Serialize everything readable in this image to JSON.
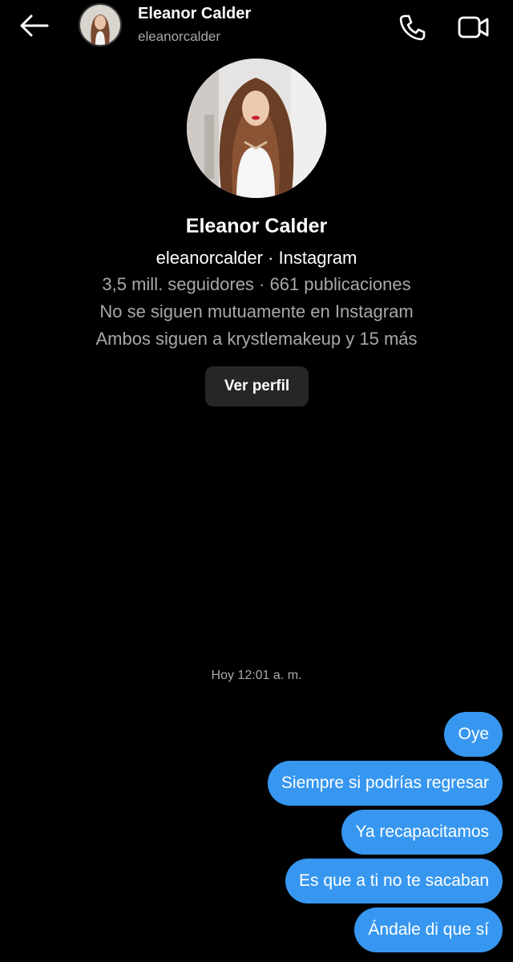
{
  "header": {
    "name": "Eleanor Calder",
    "handle": "eleanorcalder",
    "back_icon": "arrow-left-icon",
    "call_icon": "phone-icon",
    "video_icon": "video-camera-icon"
  },
  "profile": {
    "name": "Eleanor Calder",
    "handle_line": "eleanorcalder · Instagram",
    "stats_line": "3,5 mill. seguidores · 661 publicaciones",
    "mutual_line": "No se siguen mutuamente en Instagram",
    "common_line": "Ambos siguen a krystlemakeup y 15 más",
    "view_profile_label": "Ver perfil"
  },
  "conversation": {
    "timestamp": "Hoy 12:01 a. m.",
    "messages": [
      {
        "text": "Oye",
        "sender": "me"
      },
      {
        "text": "Siempre si podrías regresar",
        "sender": "me"
      },
      {
        "text": "Ya recapacitamos",
        "sender": "me"
      },
      {
        "text": "Es que a ti no te sacaban",
        "sender": "me"
      },
      {
        "text": "Ándale di que sí",
        "sender": "me"
      }
    ]
  },
  "colors": {
    "background": "#000000",
    "sent_bubble": "#3797f0",
    "secondary_text": "#a8a8a8",
    "button_bg": "#262626"
  }
}
